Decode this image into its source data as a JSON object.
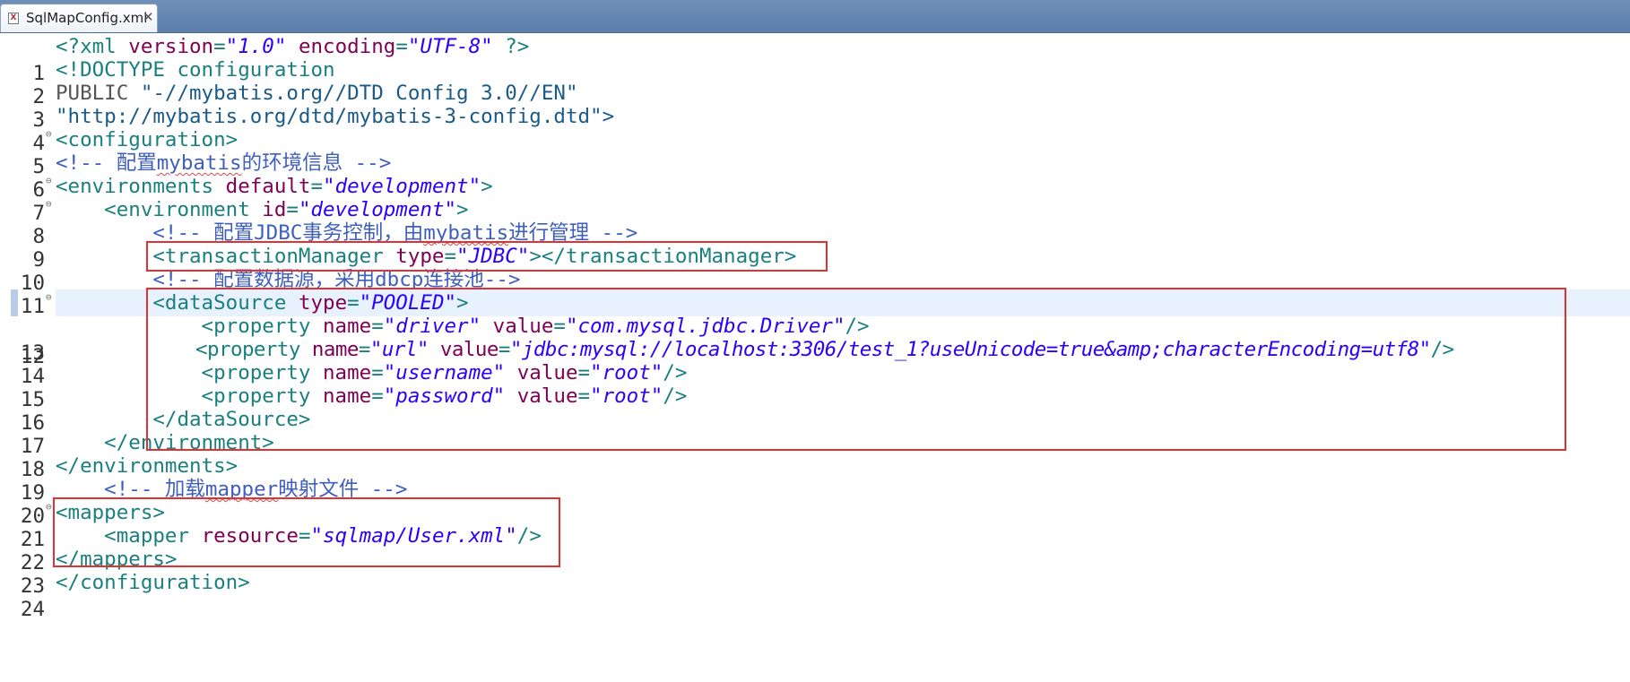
{
  "tab": {
    "label": "SqlMapConfig.xml",
    "close": "✕",
    "icon": "xml-file-icon"
  },
  "lines": {
    "l1": {
      "num": "1",
      "t1": "<?xml ",
      "a1": "version",
      "t2": "=",
      "v1": "\"1.0\"",
      "t3": " ",
      "a2": "encoding",
      "t4": "=",
      "v2": "\"UTF-8\"",
      "t5": " ?>"
    },
    "l2": {
      "num": "2",
      "p1": "<!DOCTYPE configuration"
    },
    "l3": {
      "num": "3",
      "p1": "PUBLIC ",
      "s1": "\"-//mybatis.org//DTD Config 3.0//EN\""
    },
    "l4": {
      "num": "4",
      "s1": "\"http://mybatis.org/dtd/mybatis-3-config.dtd\">"
    },
    "l5": {
      "num": "5",
      "t1": "<configuration>"
    },
    "l6": {
      "num": "6",
      "c1": "<!-- 配置",
      "c2": "mybatis",
      "c3": "的环境信息 -->"
    },
    "l7": {
      "num": "7",
      "t1": "<environments ",
      "a1": "default",
      "t2": "=",
      "v1": "\"development\"",
      "t3": ">"
    },
    "l8": {
      "num": "8",
      "t1": "    <environment ",
      "a1": "id",
      "t2": "=",
      "v1": "\"development\"",
      "t3": ">"
    },
    "l9": {
      "num": "9",
      "c1": "        <!-- 配置JDBC事务控制，由",
      "c2": "mybatis",
      "c3": "进行管理 -->"
    },
    "l10": {
      "num": "10",
      "t1": "        <transactionManager ",
      "a1": "type",
      "t2": "=",
      "v1": "\"JDBC\"",
      "t3": "></transactionManager>"
    },
    "l11": {
      "num": "11",
      "c1": "        <!-- 配置数据源，采用",
      "c2": "dbcp",
      "c3": "连接池-->"
    },
    "l12": {
      "num": "12",
      "t1": "        <dataSource ",
      "a1": "type",
      "t2": "=",
      "v1": "\"POOLED\"",
      "t3": ">"
    },
    "l13": {
      "num": "13",
      "t1": "            <property ",
      "a1": "name",
      "t2": "=",
      "v1": "\"driver\"",
      "t3": " ",
      "a2": "value",
      "t4": "=",
      "v2": "\"com.mysql.jdbc.Driver\"",
      "t5": "/>"
    },
    "l14": {
      "num": "14",
      "t1": "            <property ",
      "a1": "name",
      "t2": "=",
      "v1": "\"url\"",
      "t3": " ",
      "a2": "value",
      "t4": "=",
      "v2": "\"jdbc:mysql://localhost:3306/test_1?useUnicode=true&amp;characterEncoding=utf8\"",
      "t5": "/>"
    },
    "l15": {
      "num": "15",
      "t1": "            <property ",
      "a1": "name",
      "t2": "=",
      "v1": "\"username\"",
      "t3": " ",
      "a2": "value",
      "t4": "=",
      "v2": "\"root\"",
      "t5": "/>"
    },
    "l16": {
      "num": "16",
      "t1": "            <property ",
      "a1": "name",
      "t2": "=",
      "v1": "\"password\"",
      "t3": " ",
      "a2": "value",
      "t4": "=",
      "v2": "\"root\"",
      "t5": "/>"
    },
    "l17": {
      "num": "17",
      "t1": "        </dataSource>"
    },
    "l18": {
      "num": "18",
      "t1": "    </environment>"
    },
    "l19": {
      "num": "19",
      "t1": "</environments>"
    },
    "l20": {
      "num": "20",
      "c1": "    <!-- 加载",
      "c2": "mapper",
      "c3": "映射文件 -->"
    },
    "l21": {
      "num": "21",
      "t1": "<mappers>"
    },
    "l22": {
      "num": "22",
      "t1": "    <mapper ",
      "a1": "resource",
      "t2": "=",
      "v1": "\"sqlmap/User.xml\"",
      "t3": "/>"
    },
    "l23": {
      "num": "23",
      "t1": "</mappers>"
    },
    "l24": {
      "num": "24",
      "t1": "</configuration>"
    }
  },
  "fold_marker": "⊖",
  "highlight_color": "#e03232"
}
